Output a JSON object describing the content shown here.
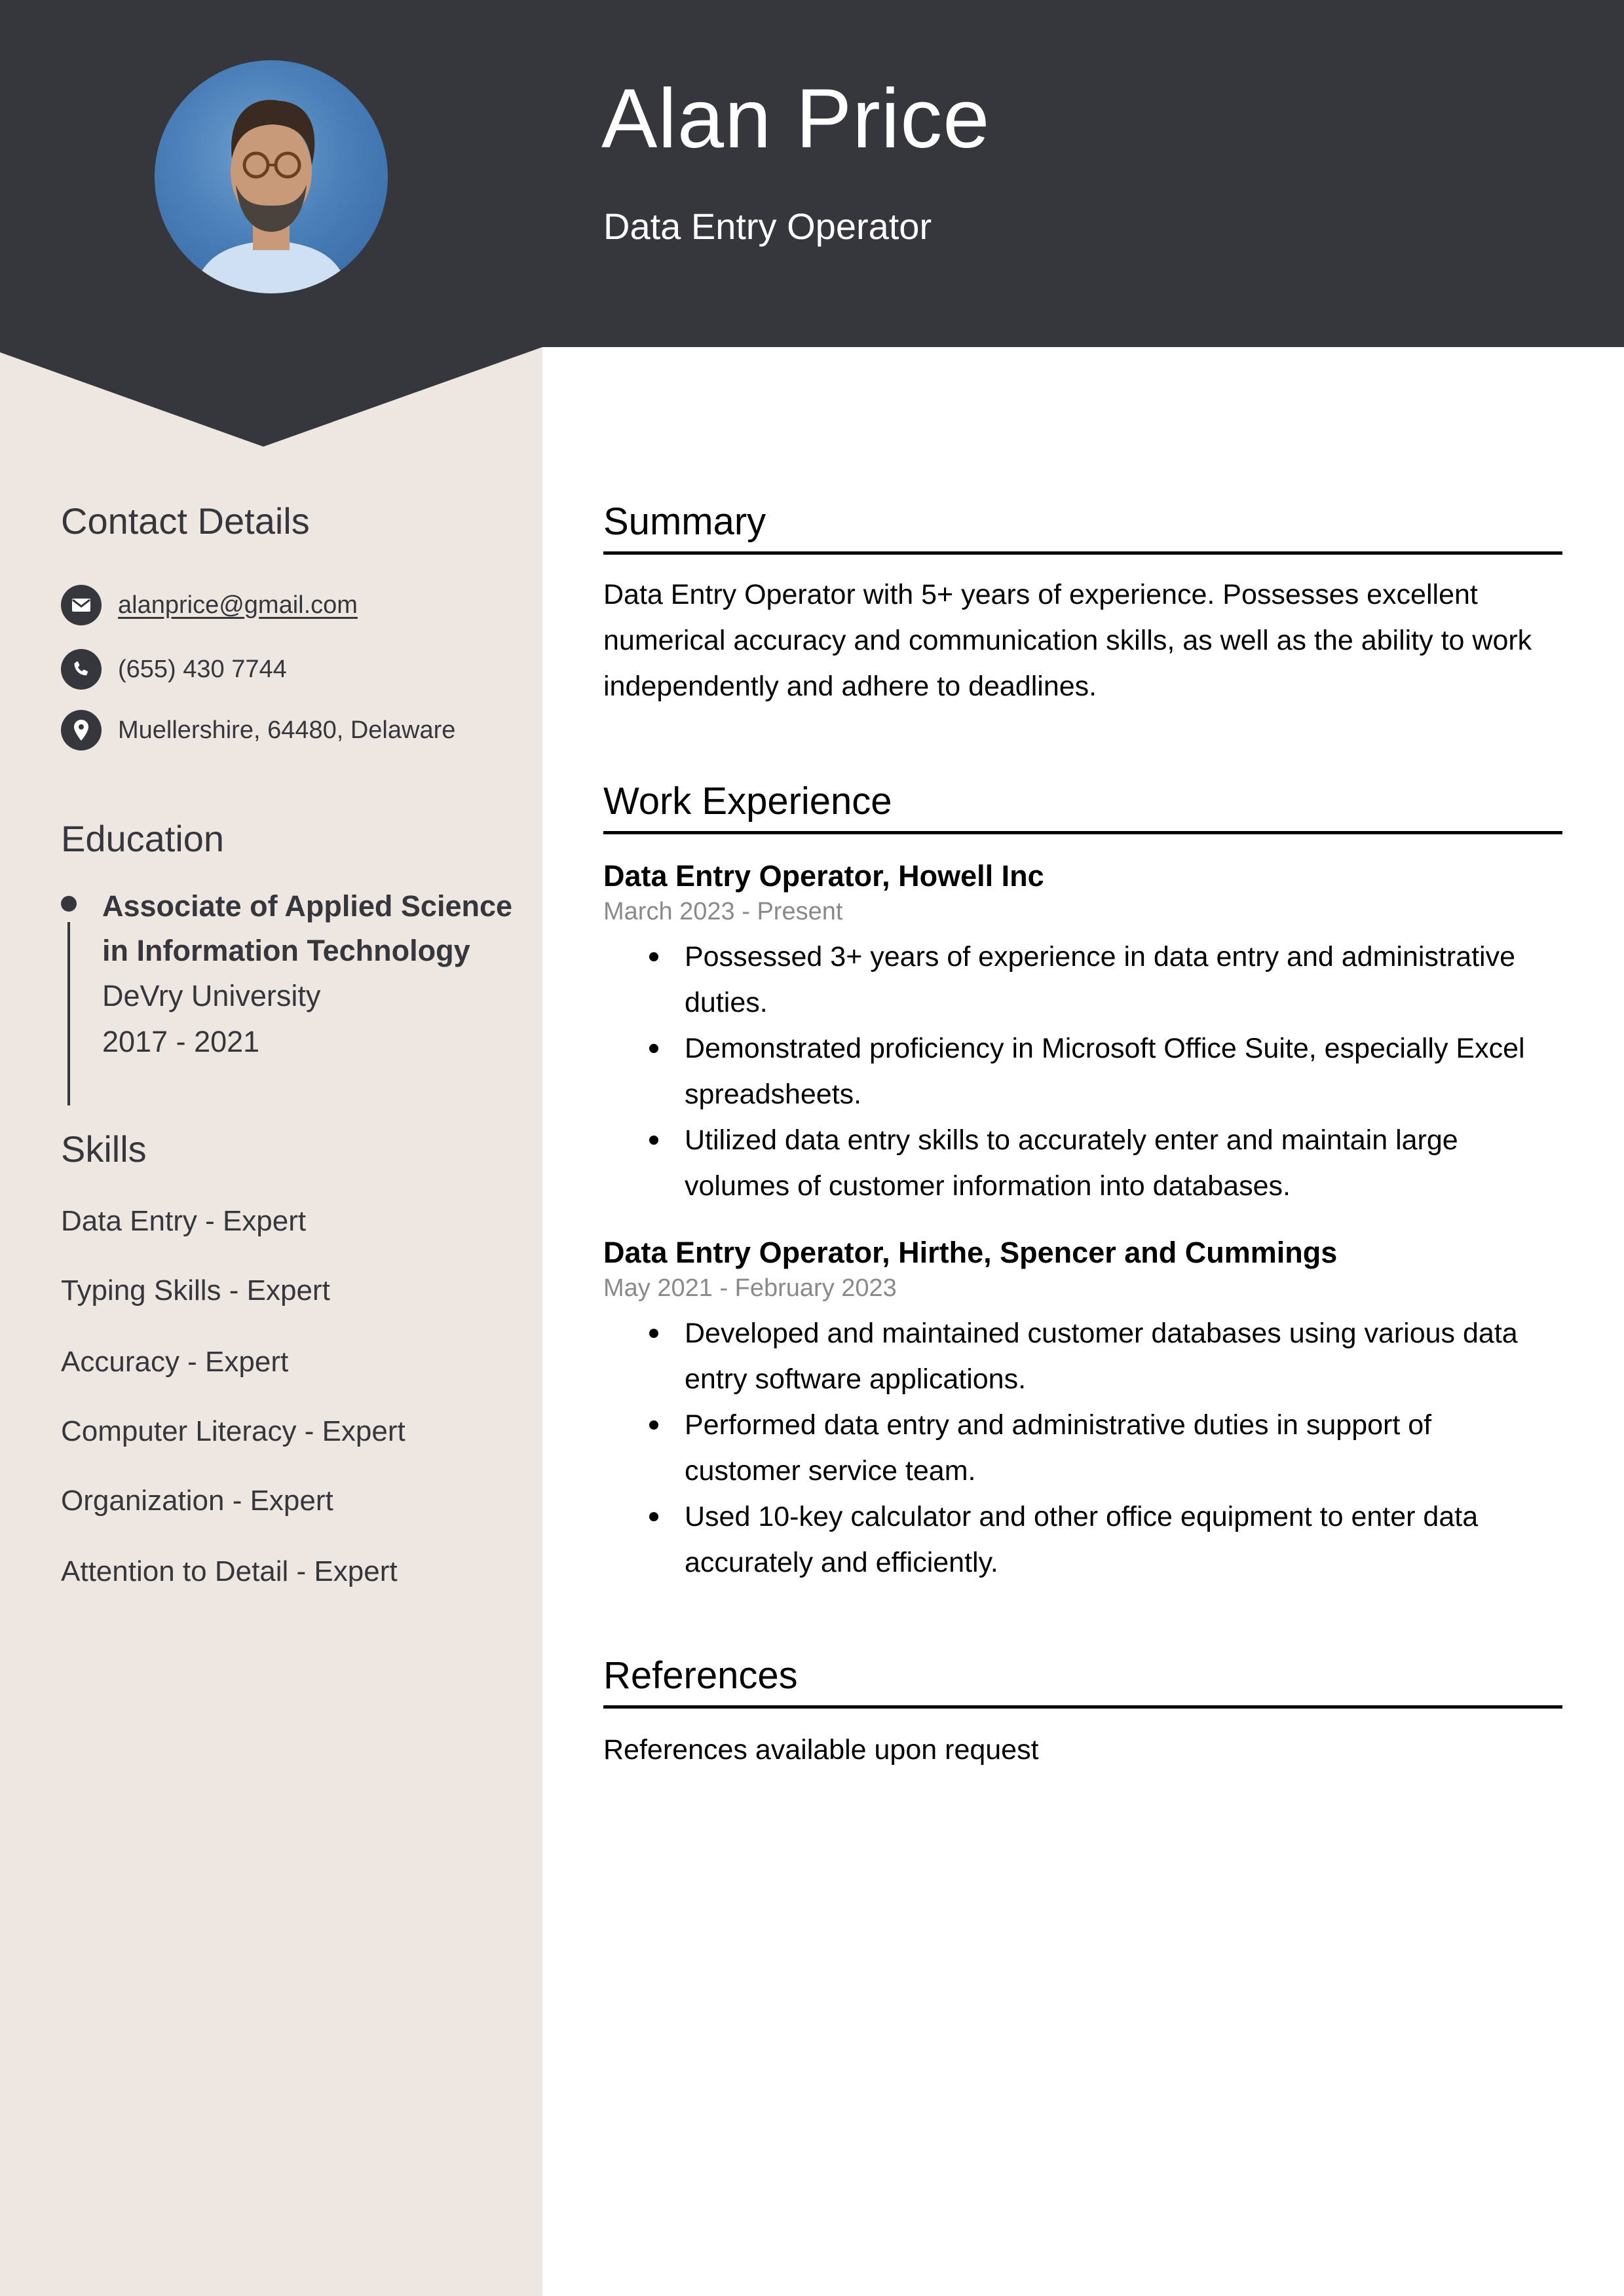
{
  "header": {
    "name": "Alan Price",
    "title": "Data Entry Operator",
    "photo_alt": "profile-photo"
  },
  "colors": {
    "header_bg": "#36373d",
    "sidebar_bg": "#ede6e1",
    "text_dark": "#36373d",
    "date_gray": "#8a8a8a"
  },
  "sidebar": {
    "contact": {
      "heading": "Contact Details",
      "items": [
        {
          "icon": "envelope-icon",
          "text": "alanprice@gmail.com"
        },
        {
          "icon": "phone-icon",
          "text": "(655) 430 7744"
        },
        {
          "icon": "map-pin-icon",
          "text": "Muellershire, 64480, Delaware"
        }
      ]
    },
    "education": {
      "heading": "Education",
      "items": [
        {
          "degree_line1": "Associate of Applied Science",
          "degree_line2": "in Information Technology",
          "school": "DeVry University",
          "years": "2017 - 2021"
        }
      ]
    },
    "skills": {
      "heading": "Skills",
      "items": [
        "Data Entry - Expert",
        "Typing Skills - Expert",
        "Accuracy - Expert",
        "Computer Literacy - Expert",
        "Organization - Expert",
        "Attention to Detail - Expert"
      ]
    }
  },
  "main": {
    "summary": {
      "heading": "Summary",
      "text": "Data Entry Operator with 5+ years of experience. Possesses excellent numerical accuracy and communication skills, as well as the ability to work independently and adhere to deadlines."
    },
    "experience": {
      "heading": "Work Experience",
      "jobs": [
        {
          "title": "Data Entry Operator, Howell Inc",
          "dates": "March 2023 - Present",
          "bullets": [
            "Possessed 3+ years of experience in data entry and administrative duties.",
            "Demonstrated proficiency in Microsoft Office Suite, especially Excel spreadsheets.",
            "Utilized data entry skills to accurately enter and maintain large volumes of customer information into databases."
          ]
        },
        {
          "title": "Data Entry Operator, Hirthe, Spencer and Cummings",
          "dates": "May 2021 - February 2023",
          "bullets": [
            "Developed and maintained customer databases using various data entry software applications.",
            "Performed data entry and administrative duties in support of customer service team.",
            "Used 10-key calculator and other office equipment to enter data accurately and efficiently."
          ]
        }
      ]
    },
    "references": {
      "heading": "References",
      "text": "References available upon request"
    }
  }
}
